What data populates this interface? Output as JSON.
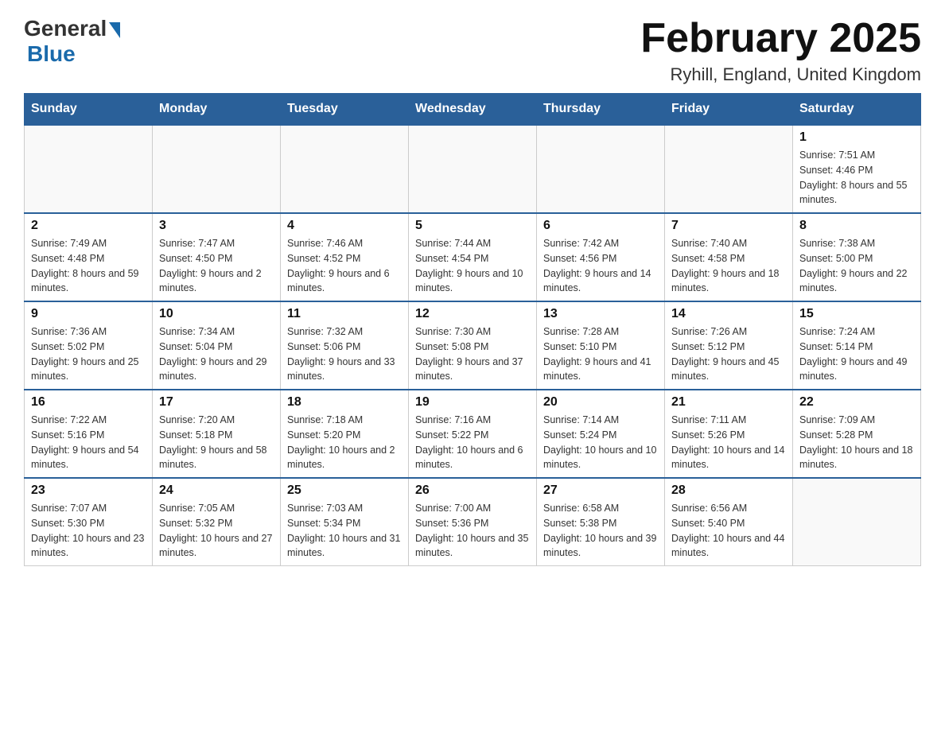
{
  "header": {
    "logo_general": "General",
    "logo_blue": "Blue",
    "month_title": "February 2025",
    "location": "Ryhill, England, United Kingdom"
  },
  "calendar": {
    "days_of_week": [
      "Sunday",
      "Monday",
      "Tuesday",
      "Wednesday",
      "Thursday",
      "Friday",
      "Saturday"
    ],
    "weeks": [
      [
        {
          "day": "",
          "info": ""
        },
        {
          "day": "",
          "info": ""
        },
        {
          "day": "",
          "info": ""
        },
        {
          "day": "",
          "info": ""
        },
        {
          "day": "",
          "info": ""
        },
        {
          "day": "",
          "info": ""
        },
        {
          "day": "1",
          "info": "Sunrise: 7:51 AM\nSunset: 4:46 PM\nDaylight: 8 hours and 55 minutes."
        }
      ],
      [
        {
          "day": "2",
          "info": "Sunrise: 7:49 AM\nSunset: 4:48 PM\nDaylight: 8 hours and 59 minutes."
        },
        {
          "day": "3",
          "info": "Sunrise: 7:47 AM\nSunset: 4:50 PM\nDaylight: 9 hours and 2 minutes."
        },
        {
          "day": "4",
          "info": "Sunrise: 7:46 AM\nSunset: 4:52 PM\nDaylight: 9 hours and 6 minutes."
        },
        {
          "day": "5",
          "info": "Sunrise: 7:44 AM\nSunset: 4:54 PM\nDaylight: 9 hours and 10 minutes."
        },
        {
          "day": "6",
          "info": "Sunrise: 7:42 AM\nSunset: 4:56 PM\nDaylight: 9 hours and 14 minutes."
        },
        {
          "day": "7",
          "info": "Sunrise: 7:40 AM\nSunset: 4:58 PM\nDaylight: 9 hours and 18 minutes."
        },
        {
          "day": "8",
          "info": "Sunrise: 7:38 AM\nSunset: 5:00 PM\nDaylight: 9 hours and 22 minutes."
        }
      ],
      [
        {
          "day": "9",
          "info": "Sunrise: 7:36 AM\nSunset: 5:02 PM\nDaylight: 9 hours and 25 minutes."
        },
        {
          "day": "10",
          "info": "Sunrise: 7:34 AM\nSunset: 5:04 PM\nDaylight: 9 hours and 29 minutes."
        },
        {
          "day": "11",
          "info": "Sunrise: 7:32 AM\nSunset: 5:06 PM\nDaylight: 9 hours and 33 minutes."
        },
        {
          "day": "12",
          "info": "Sunrise: 7:30 AM\nSunset: 5:08 PM\nDaylight: 9 hours and 37 minutes."
        },
        {
          "day": "13",
          "info": "Sunrise: 7:28 AM\nSunset: 5:10 PM\nDaylight: 9 hours and 41 minutes."
        },
        {
          "day": "14",
          "info": "Sunrise: 7:26 AM\nSunset: 5:12 PM\nDaylight: 9 hours and 45 minutes."
        },
        {
          "day": "15",
          "info": "Sunrise: 7:24 AM\nSunset: 5:14 PM\nDaylight: 9 hours and 49 minutes."
        }
      ],
      [
        {
          "day": "16",
          "info": "Sunrise: 7:22 AM\nSunset: 5:16 PM\nDaylight: 9 hours and 54 minutes."
        },
        {
          "day": "17",
          "info": "Sunrise: 7:20 AM\nSunset: 5:18 PM\nDaylight: 9 hours and 58 minutes."
        },
        {
          "day": "18",
          "info": "Sunrise: 7:18 AM\nSunset: 5:20 PM\nDaylight: 10 hours and 2 minutes."
        },
        {
          "day": "19",
          "info": "Sunrise: 7:16 AM\nSunset: 5:22 PM\nDaylight: 10 hours and 6 minutes."
        },
        {
          "day": "20",
          "info": "Sunrise: 7:14 AM\nSunset: 5:24 PM\nDaylight: 10 hours and 10 minutes."
        },
        {
          "day": "21",
          "info": "Sunrise: 7:11 AM\nSunset: 5:26 PM\nDaylight: 10 hours and 14 minutes."
        },
        {
          "day": "22",
          "info": "Sunrise: 7:09 AM\nSunset: 5:28 PM\nDaylight: 10 hours and 18 minutes."
        }
      ],
      [
        {
          "day": "23",
          "info": "Sunrise: 7:07 AM\nSunset: 5:30 PM\nDaylight: 10 hours and 23 minutes."
        },
        {
          "day": "24",
          "info": "Sunrise: 7:05 AM\nSunset: 5:32 PM\nDaylight: 10 hours and 27 minutes."
        },
        {
          "day": "25",
          "info": "Sunrise: 7:03 AM\nSunset: 5:34 PM\nDaylight: 10 hours and 31 minutes."
        },
        {
          "day": "26",
          "info": "Sunrise: 7:00 AM\nSunset: 5:36 PM\nDaylight: 10 hours and 35 minutes."
        },
        {
          "day": "27",
          "info": "Sunrise: 6:58 AM\nSunset: 5:38 PM\nDaylight: 10 hours and 39 minutes."
        },
        {
          "day": "28",
          "info": "Sunrise: 6:56 AM\nSunset: 5:40 PM\nDaylight: 10 hours and 44 minutes."
        },
        {
          "day": "",
          "info": ""
        }
      ]
    ]
  }
}
